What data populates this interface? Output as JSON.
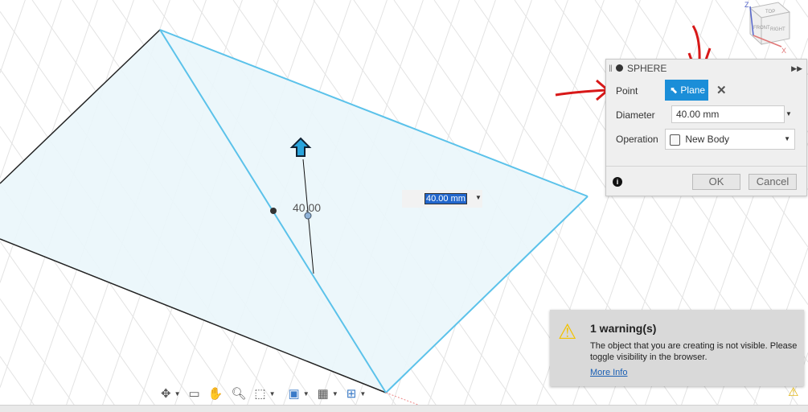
{
  "dialog": {
    "title": "SPHERE",
    "point_label": "Point",
    "point_button": "Plane",
    "diameter_label": "Diameter",
    "diameter_value": "40.00 mm",
    "operation_label": "Operation",
    "operation_value": "New Body",
    "ok": "OK",
    "cancel": "Cancel"
  },
  "canvas": {
    "dimension_text": "40.00",
    "dimension_input": "40.00 mm"
  },
  "viewcube": {
    "top": "TOP",
    "front": "FRONT",
    "right": "RIGHT",
    "z": "Z",
    "x": "X"
  },
  "warning": {
    "title": "1 warning(s)",
    "message": "The object that you are creating is not visible. Please toggle visibility in the browser.",
    "link": "More Info"
  },
  "colors": {
    "accent": "#1b8ed8",
    "plane_edge": "#5bc2ea",
    "annotation": "#d81818"
  }
}
